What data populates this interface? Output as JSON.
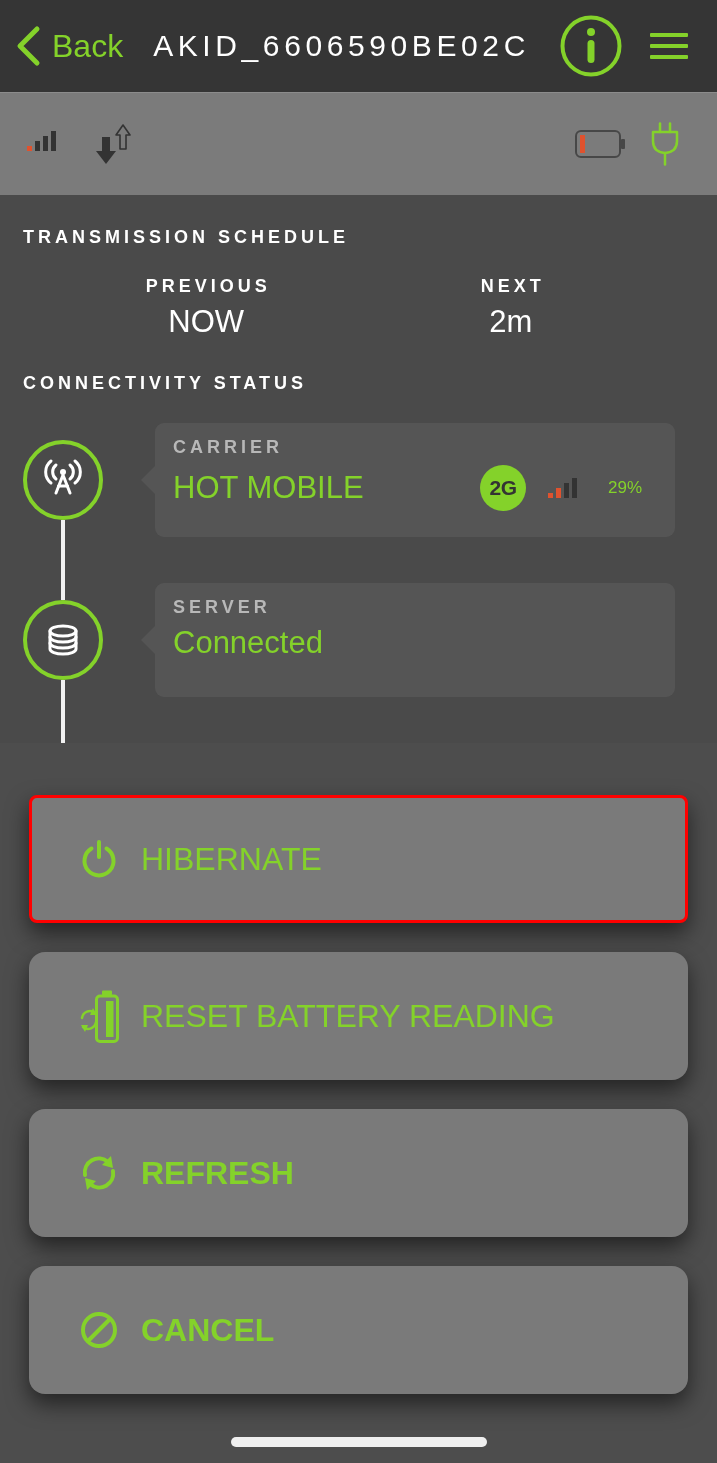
{
  "header": {
    "back_label": "Back",
    "title": "AKID_6606590BE02C"
  },
  "transmission_schedule": {
    "title": "TRANSMISSION SCHEDULE",
    "items": [
      {
        "label": "PREVIOUS",
        "value": "NOW"
      },
      {
        "label": "NEXT",
        "value": "2m"
      }
    ]
  },
  "connectivity_status": {
    "title": "CONNECTIVITY STATUS",
    "items": [
      {
        "kind": "carrier",
        "label": "CARRIER",
        "value": "HOT MOBILE",
        "network_badge": "2G",
        "signal_percent": "29%"
      },
      {
        "kind": "server",
        "label": "SERVER",
        "value": "Connected"
      }
    ]
  },
  "actions": [
    {
      "kind": "hibernate",
      "label": "HIBERNATE",
      "highlighted": true
    },
    {
      "kind": "reset-battery",
      "label": "RESET BATTERY READING",
      "highlighted": false
    },
    {
      "kind": "refresh",
      "label": "REFRESH",
      "highlighted": false
    },
    {
      "kind": "cancel",
      "label": "CANCEL",
      "highlighted": false
    }
  ]
}
